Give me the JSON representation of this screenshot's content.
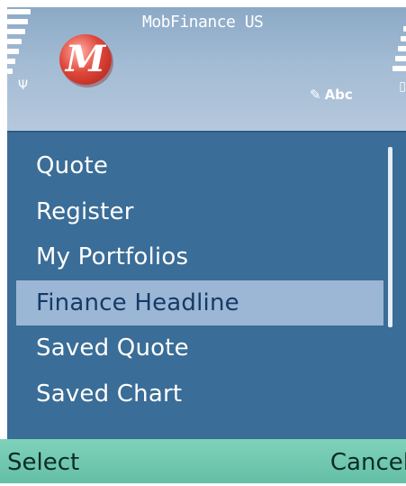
{
  "status_bar": {
    "app_title": "MobFinance US",
    "app_icon_letter": "M",
    "input_mode": "Abc",
    "signal_icon": "antenna-icon",
    "battery_icon": "battery-icon"
  },
  "menu": {
    "items": [
      {
        "label": "Quote",
        "selected": false
      },
      {
        "label": "Register",
        "selected": false
      },
      {
        "label": "My Portfolios",
        "selected": false
      },
      {
        "label": "Finance Headline",
        "selected": true
      },
      {
        "label": "Saved Quote",
        "selected": false
      },
      {
        "label": "Saved Chart",
        "selected": false
      }
    ]
  },
  "softkeys": {
    "left": "Select",
    "right": "Cancel"
  },
  "colors": {
    "list_background": "#3a6d97",
    "selection": "#9bb7d5",
    "softkey_bar": "#6ec7ad"
  }
}
